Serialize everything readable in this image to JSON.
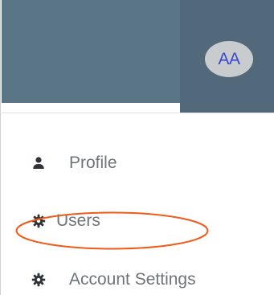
{
  "header": {
    "background_color": "#5a7585",
    "avatar": {
      "initials": "AA",
      "text_color": "#3b47c9",
      "background_color": "#c9cccf"
    }
  },
  "menu": {
    "items": [
      {
        "label": "Profile",
        "icon": "person-icon"
      },
      {
        "label": "Users",
        "icon": "gear-icon"
      },
      {
        "label": "Account Settings",
        "icon": "gear-icon"
      }
    ]
  },
  "annotation": {
    "shape": "ellipse",
    "color": "#f05a1a",
    "target": "Users"
  }
}
